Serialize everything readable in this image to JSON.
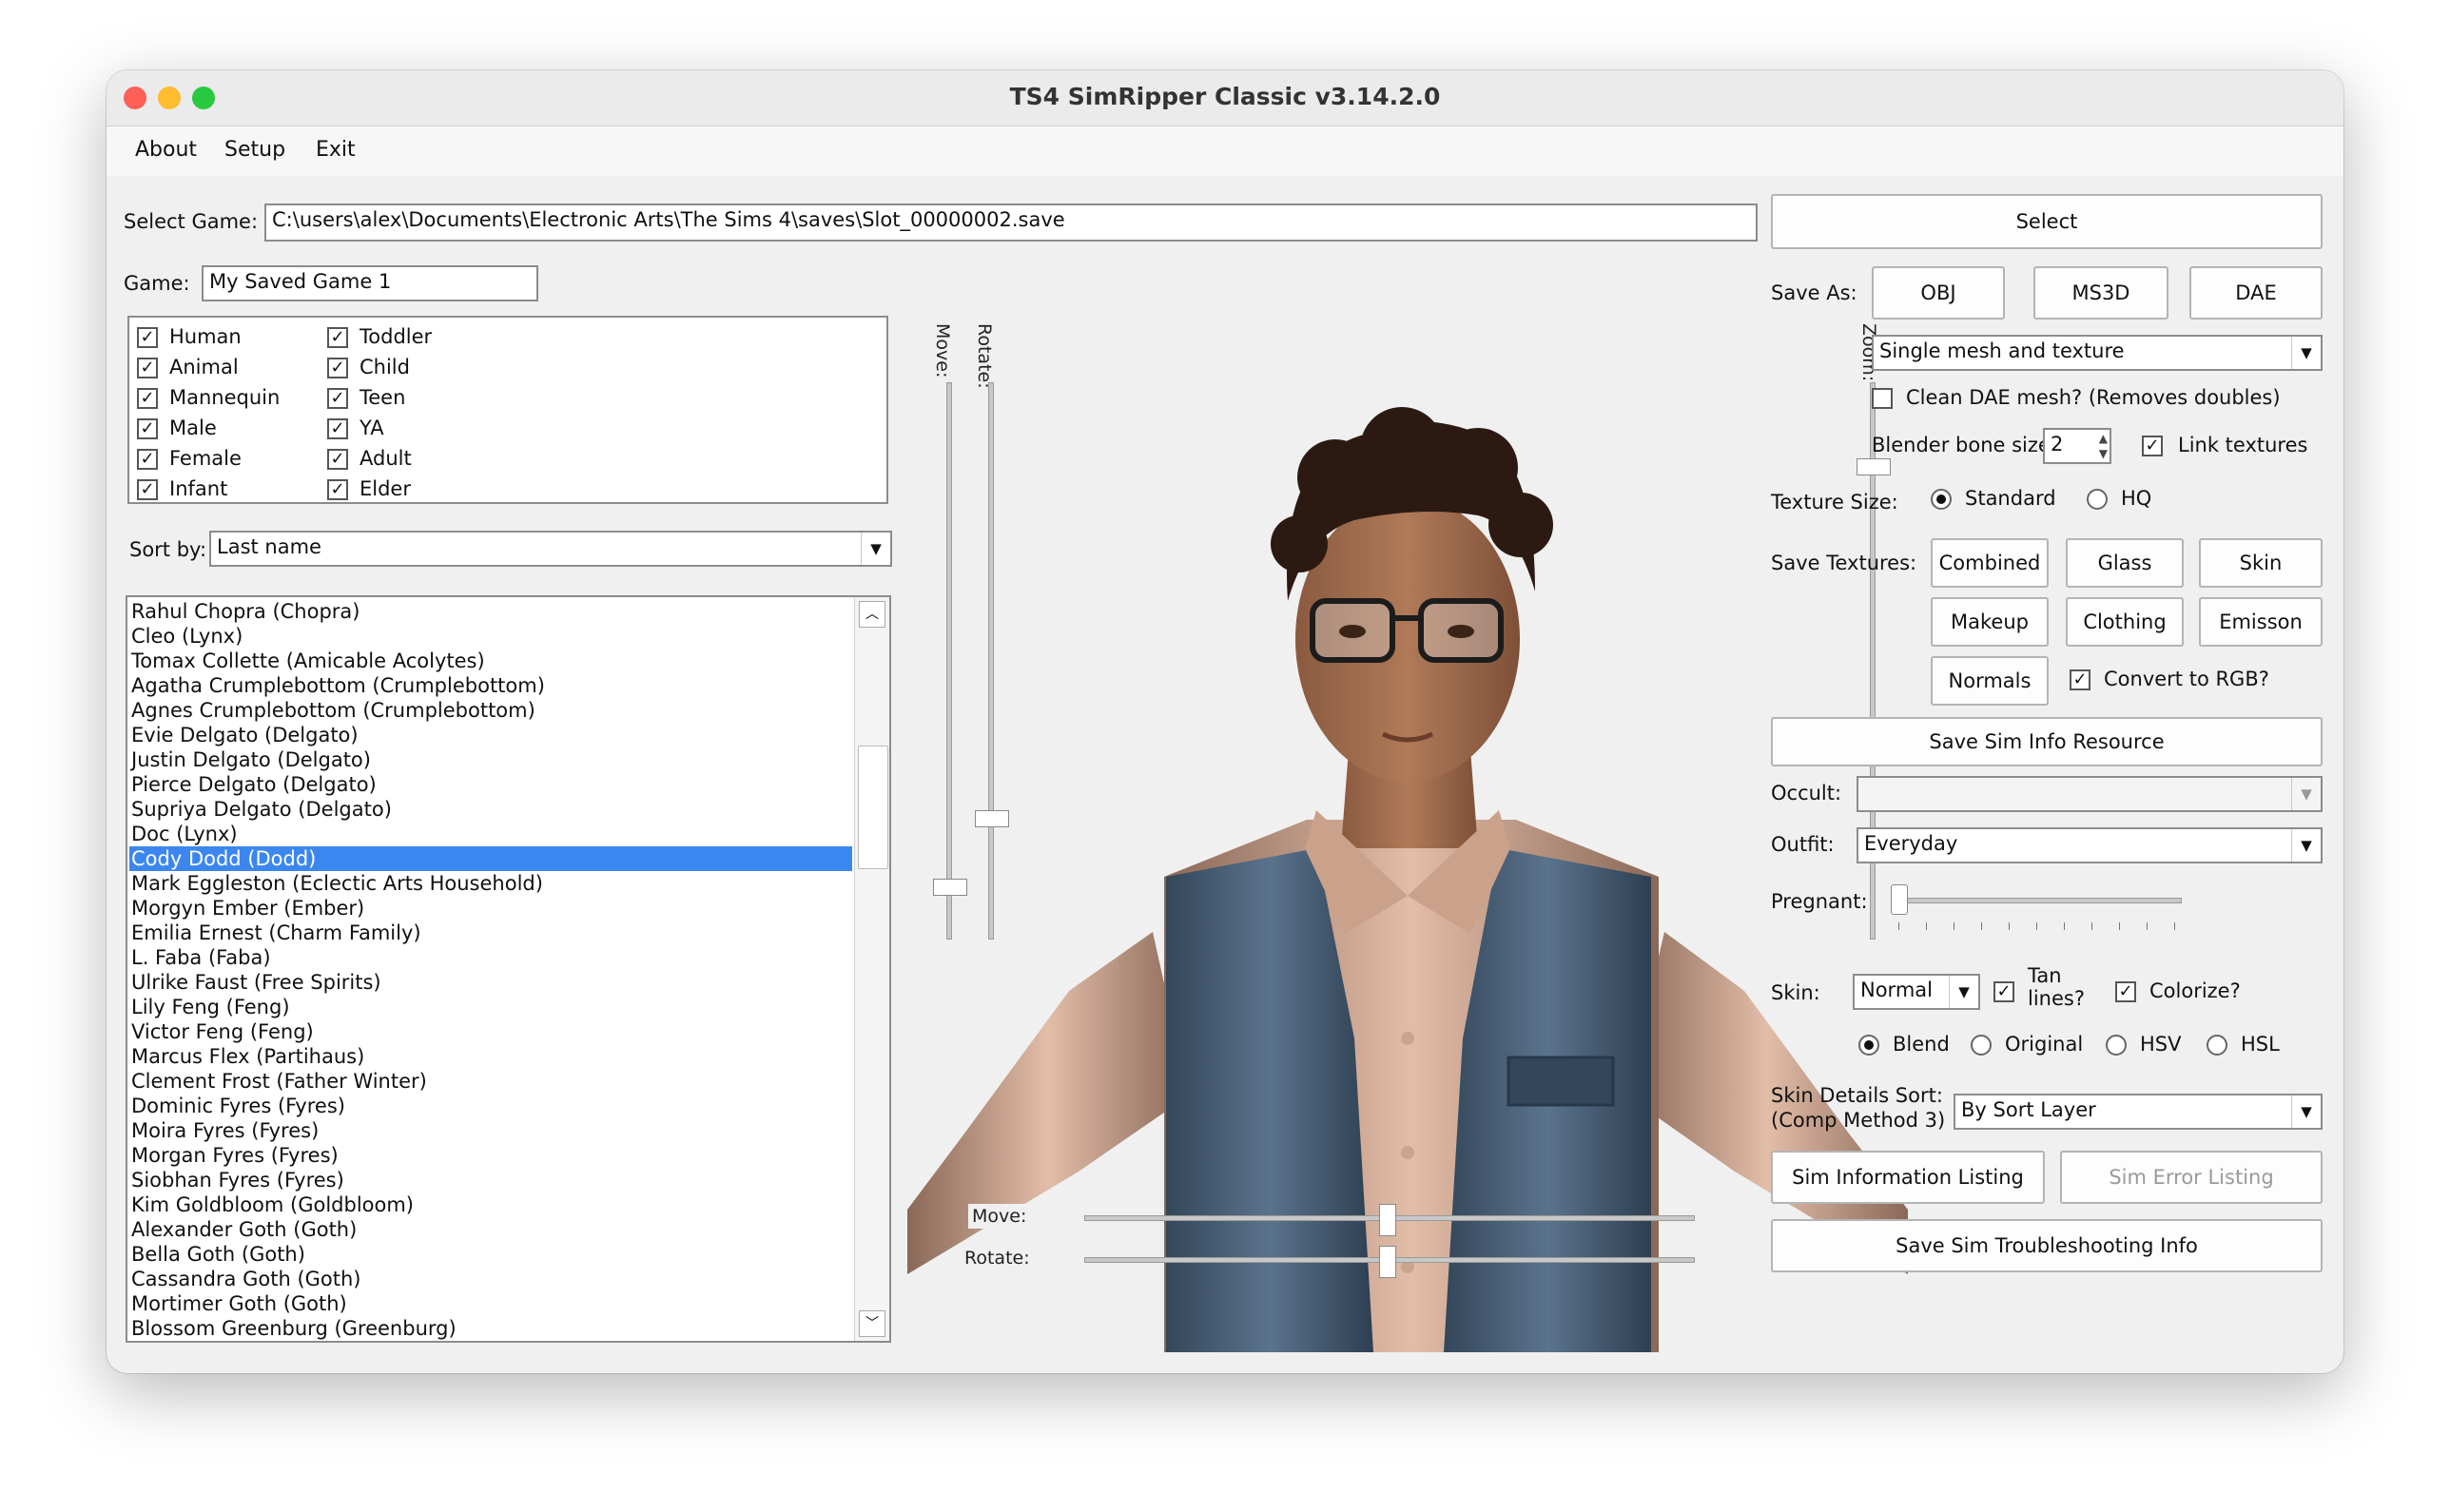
{
  "window": {
    "title": "TS4 SimRipper Classic v3.14.2.0"
  },
  "colors": {
    "close": "#fe5f57",
    "minimize": "#febc2e",
    "zoom": "#28c840",
    "selection": "#3b87ef"
  },
  "menu": {
    "about": "About",
    "setup": "Setup",
    "exit": "Exit"
  },
  "game_select": {
    "label": "Select Game:",
    "path": "C:\\users\\alex\\Documents\\Electronic Arts\\The Sims 4\\saves\\Slot_00000002.save",
    "select_button": "Select",
    "game_label": "Game:",
    "game_name": "My Saved Game 1"
  },
  "filters": {
    "col1": [
      {
        "label": "Human",
        "checked": true
      },
      {
        "label": "Animal",
        "checked": true
      },
      {
        "label": "Mannequin",
        "checked": true
      },
      {
        "label": "Male",
        "checked": true
      },
      {
        "label": "Female",
        "checked": true
      },
      {
        "label": "Infant",
        "checked": true
      }
    ],
    "col2": [
      {
        "label": "Toddler",
        "checked": true
      },
      {
        "label": "Child",
        "checked": true
      },
      {
        "label": "Teen",
        "checked": true
      },
      {
        "label": "YA",
        "checked": true
      },
      {
        "label": "Adult",
        "checked": true
      },
      {
        "label": "Elder",
        "checked": true
      }
    ]
  },
  "sort": {
    "label": "Sort by:",
    "value": "Last name"
  },
  "sims": [
    "Rahul Chopra (Chopra)",
    "Cleo  (Lynx)",
    "Tomax Collette (Amicable Acolytes)",
    "Agatha Crumplebottom (Crumplebottom)",
    "Agnes Crumplebottom (Crumplebottom)",
    "Evie Delgato (Delgato)",
    "Justin Delgato (Delgato)",
    "Pierce Delgato (Delgato)",
    "Supriya Delgato (Delgato)",
    "Doc  (Lynx)",
    "Cody Dodd (Dodd)",
    "Mark Eggleston (Eclectic Arts Household)",
    "Morgyn Ember (Ember)",
    "Emilia Ernest (Charm Family)",
    "L. Faba (Faba)",
    "Ulrike Faust (Free Spirits)",
    "Lily Feng (Feng)",
    "Victor Feng (Feng)",
    "Marcus Flex (Partihaus)",
    "Clement Frost (Father Winter)",
    "Dominic Fyres (Fyres)",
    "Moira Fyres (Fyres)",
    "Morgan Fyres (Fyres)",
    "Siobhan Fyres (Fyres)",
    "Kim Goldbloom (Goldbloom)",
    "Alexander Goth (Goth)",
    "Bella Goth (Goth)",
    "Cassandra Goth (Goth)",
    "Mortimer Goth (Goth)",
    "Blossom Greenburg (Greenburg)"
  ],
  "selected_index": 10,
  "viewer": {
    "move": "Move:",
    "rotate": "Rotate:",
    "zoom": "Zoom:"
  },
  "save_as": {
    "label": "Save As:",
    "obj": "OBJ",
    "ms3d": "MS3D",
    "dae": "DAE",
    "mesh_mode": "Single mesh and texture"
  },
  "options": {
    "clean_dae": "Clean DAE mesh? (Removes doubles)",
    "clean_dae_checked": false,
    "bone_size_label": "Blender bone size",
    "bone_size": "2",
    "link_textures": "Link textures",
    "link_textures_checked": true
  },
  "texture_size": {
    "label": "Texture Size:",
    "standard": "Standard",
    "hq": "HQ",
    "selected": "Standard"
  },
  "save_textures": {
    "label": "Save Textures:",
    "combined": "Combined",
    "glass": "Glass",
    "skin": "Skin",
    "makeup": "Makeup",
    "clothing": "Clothing",
    "emission": "Emisson",
    "normals": "Normals",
    "convert_rgb": "Convert to RGB?",
    "convert_rgb_checked": true
  },
  "sim_info_resource": "Save Sim Info Resource",
  "occult": {
    "label": "Occult:",
    "value": ""
  },
  "outfit": {
    "label": "Outfit:",
    "value": "Everyday"
  },
  "pregnant": {
    "label": "Pregnant:",
    "level": 0
  },
  "skin": {
    "label": "Skin:",
    "value": "Normal",
    "tan_lines": "Tan lines?",
    "tan_lines_checked": true,
    "colorize": "Colorize?",
    "colorize_checked": true,
    "blend": "Blend",
    "original": "Original",
    "hsv": "HSV",
    "hsl": "HSL",
    "selected": "Blend"
  },
  "skin_details": {
    "label1": "Skin Details Sort:",
    "label2": "(Comp Method 3)",
    "value": "By Sort Layer"
  },
  "bottom": {
    "info_listing": "Sim Information Listing",
    "error_listing": "Sim Error Listing",
    "troubleshoot": "Save Sim Troubleshooting Info"
  }
}
